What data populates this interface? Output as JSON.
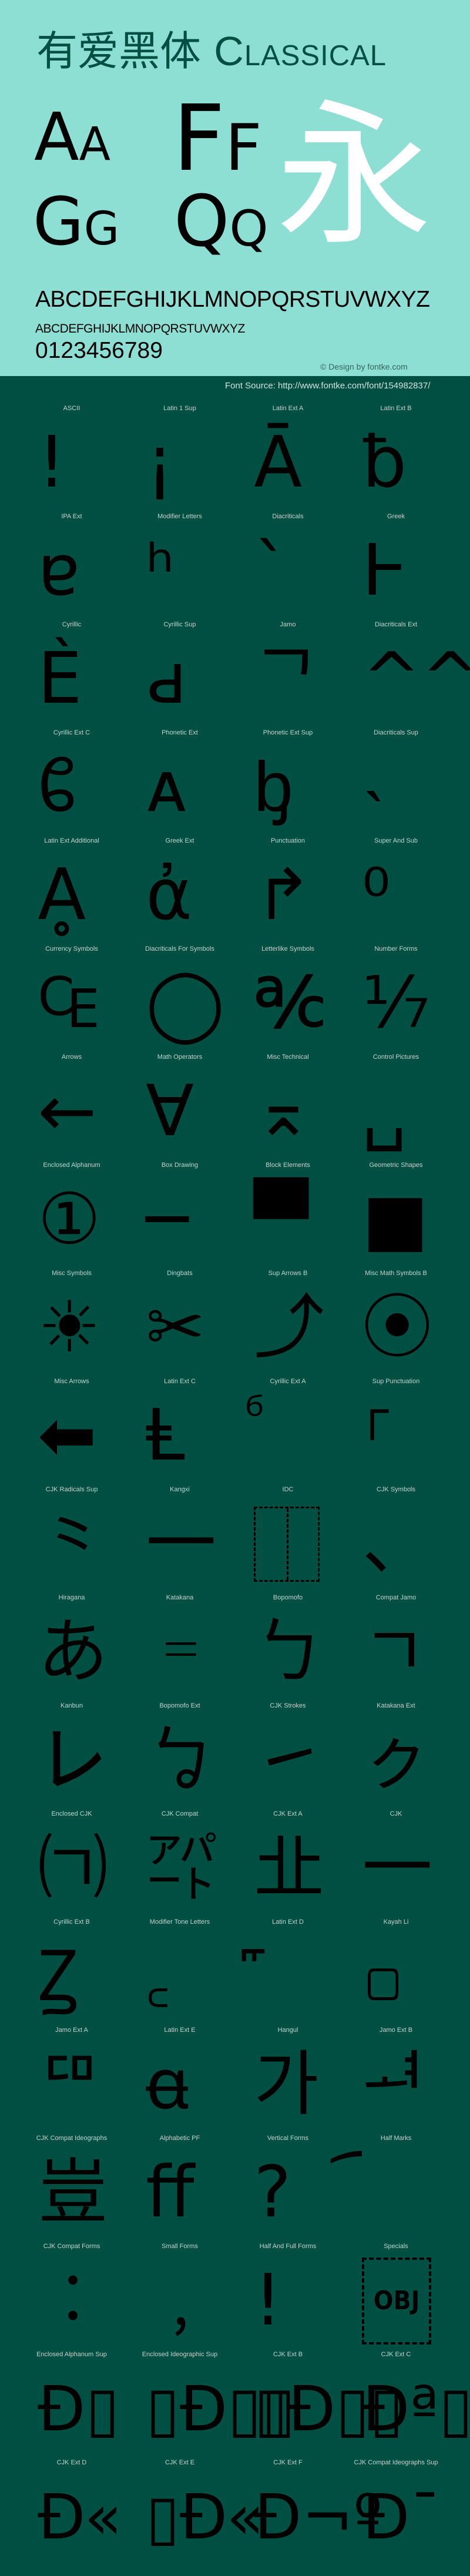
{
  "colors": {
    "header_bg": "#8ddfd3",
    "page_bg": "#004f43",
    "title": "#004f43",
    "glyph": "#000000",
    "label": "#c6d3cf"
  },
  "header": {
    "title_cjk": "有爱黑体",
    "title_latin": "Classical",
    "pairs": [
      {
        "upper": "A",
        "lower": "a"
      },
      {
        "upper": "F",
        "lower": "f"
      },
      {
        "upper": "G",
        "lower": "g"
      },
      {
        "upper": "Q",
        "lower": "q"
      }
    ],
    "hero_glyph": "永",
    "alphabet_upper": "ABCDEFGHIJKLMNOPQRSTUVWXYZ",
    "alphabet_lower": "abcdefghijklmnopqrstuvwxyz",
    "digits": "0123456789",
    "credit": "© Design by fontke.com"
  },
  "source": "Font Source: http://www.fontke.com/font/154982837/",
  "grid": {
    "rows": [
      [
        {
          "label": "ASCII",
          "glyph": "!"
        },
        {
          "label": "Latin 1 Sup",
          "glyph": "¡"
        },
        {
          "label": "Latin Ext A",
          "glyph": "Ā"
        },
        {
          "label": "Latin Ext B",
          "glyph": "ƀ"
        }
      ],
      [
        {
          "label": "IPA Ext",
          "glyph": "ɐ"
        },
        {
          "label": "Modifier Letters",
          "glyph": "ʰ"
        },
        {
          "label": "Diacriticals",
          "glyph": "ˋ"
        },
        {
          "label": "Greek",
          "glyph": "Ͱ"
        }
      ],
      [
        {
          "label": "Cyrillic",
          "glyph": "Ѐ"
        },
        {
          "label": "Cyrillic Sup",
          "glyph": "ԁ"
        },
        {
          "label": "Jamo",
          "glyph": "ᄀ"
        },
        {
          "label": "Diacriticals Ext",
          "glyph": "^^"
        }
      ],
      [
        {
          "label": "Cyrillic Ext C",
          "glyph": "ᲀ"
        },
        {
          "label": "Phonetic Ext",
          "glyph": "ᴀ"
        },
        {
          "label": "Phonetic Ext Sup",
          "glyph": "ᶀ"
        },
        {
          "label": "Diacriticals Sup",
          "glyph": "˴"
        }
      ],
      [
        {
          "label": "Latin Ext Additional",
          "glyph": "Ḁ"
        },
        {
          "label": "Greek Ext",
          "glyph": "ἀ"
        },
        {
          "label": "Punctuation",
          "glyph": "↱"
        },
        {
          "label": "Super And Sub",
          "glyph": "⁰"
        }
      ],
      [
        {
          "label": "Currency Symbols",
          "glyph": "₠"
        },
        {
          "label": "Diacriticals For Symbols",
          "glyph": "◯"
        },
        {
          "label": "Letterlike Symbols",
          "glyph": "℀"
        },
        {
          "label": "Number Forms",
          "glyph": "⅐"
        }
      ],
      [
        {
          "label": "Arrows",
          "glyph": "←"
        },
        {
          "label": "Math Operators",
          "glyph": "∀"
        },
        {
          "label": "Misc Technical",
          "glyph": "⌅"
        },
        {
          "label": "Control Pictures",
          "glyph": "␣"
        }
      ],
      [
        {
          "label": "Enclosed Alphanum",
          "glyph": "①"
        },
        {
          "label": "Box Drawing",
          "glyph": "─"
        },
        {
          "label": "Block Elements",
          "glyph": "▀"
        },
        {
          "label": "Geometric Shapes",
          "glyph": "■"
        }
      ],
      [
        {
          "label": "Misc Symbols",
          "glyph": "☀"
        },
        {
          "label": "Dingbats",
          "glyph": "✂"
        },
        {
          "label": "Sup Arrows B",
          "glyph": "⤴"
        },
        {
          "label": "Misc Math Symbols B",
          "glyph": "⦿"
        }
      ],
      [
        {
          "label": "Misc Arrows",
          "glyph": "⬅"
        },
        {
          "label": "Latin Ext C",
          "glyph": "Ⱡ"
        },
        {
          "label": "Cyrillic Ext A",
          "glyph": "ⷠ"
        },
        {
          "label": "Sup Punctuation",
          "glyph": "⸀"
        }
      ],
      [
        {
          "label": "CJK Radicals Sup",
          "glyph": "⺀"
        },
        {
          "label": "Kangxi",
          "glyph": "⼀"
        },
        {
          "label": "IDC",
          "glyph": "⿰"
        },
        {
          "label": "CJK Symbols",
          "glyph": "、"
        }
      ],
      [
        {
          "label": "Hiragana",
          "glyph": "あ"
        },
        {
          "label": "Katakana",
          "glyph": "゠"
        },
        {
          "label": "Bopomofo",
          "glyph": "ㄅ"
        },
        {
          "label": "Compat Jamo",
          "glyph": "ㄱ"
        }
      ],
      [
        {
          "label": "Kanbun",
          "glyph": "㆑"
        },
        {
          "label": "Bopomofo Ext",
          "glyph": "ㆠ"
        },
        {
          "label": "CJK Strokes",
          "glyph": "㇀"
        },
        {
          "label": "Katakana Ext",
          "glyph": "ㇰ"
        }
      ],
      [
        {
          "label": "Enclosed CJK",
          "glyph": "㈀"
        },
        {
          "label": "CJK Compat",
          "glyph": "㌀"
        },
        {
          "label": "CJK Ext A",
          "glyph": "㐀"
        },
        {
          "label": "CJK",
          "glyph": "一"
        }
      ],
      [
        {
          "label": "Cyrillic Ext B",
          "glyph": "Ꙁ"
        },
        {
          "label": "Modifier Tone Letters",
          "glyph": "꜀"
        },
        {
          "label": "Latin Ext D",
          "glyph": "꜠"
        },
        {
          "label": "Kayah Li",
          "glyph": "꤀"
        }
      ],
      [
        {
          "label": "Jamo Ext A",
          "glyph": "ꥠ"
        },
        {
          "label": "Latin Ext E",
          "glyph": "ꬰ"
        },
        {
          "label": "Hangul",
          "glyph": "가"
        },
        {
          "label": "Jamo Ext B",
          "glyph": "ힰ"
        }
      ],
      [
        {
          "label": "CJK Compat Ideographs",
          "glyph": "豈"
        },
        {
          "label": "Alphabetic PF",
          "glyph": "ﬀ"
        },
        {
          "label": "Vertical Forms",
          "glyph": "?"
        },
        {
          "label": "Half Marks",
          "glyph": "︠"
        }
      ],
      [
        {
          "label": "CJK Compat Forms",
          "glyph": "︰"
        },
        {
          "label": "Small Forms",
          "glyph": "﹐"
        },
        {
          "label": "Half And Full Forms",
          "glyph": "!"
        },
        {
          "label": "Specials",
          "glyph": "OBJ"
        }
      ],
      [
        {
          "label": "Enclosed Alphanum Sup",
          "glyph": "Ð▯"
        },
        {
          "label": "Enclosed Ideographic Sup",
          "glyph": "▯Ð▯▯"
        },
        {
          "label": "CJK Ext B",
          "glyph": "▯Ð▯▯"
        },
        {
          "label": "CJK Ext C",
          "glyph": "Ðª▯"
        }
      ],
      [
        {
          "label": "CJK Ext D",
          "glyph": "Ð«"
        },
        {
          "label": "CJK Ext E",
          "glyph": "▯Ð«"
        },
        {
          "label": "CJK Ext F",
          "glyph": "Ð¬º"
        },
        {
          "label": "CJK Compat Ideographs Sup",
          "glyph": "Ð¯"
        }
      ]
    ]
  }
}
